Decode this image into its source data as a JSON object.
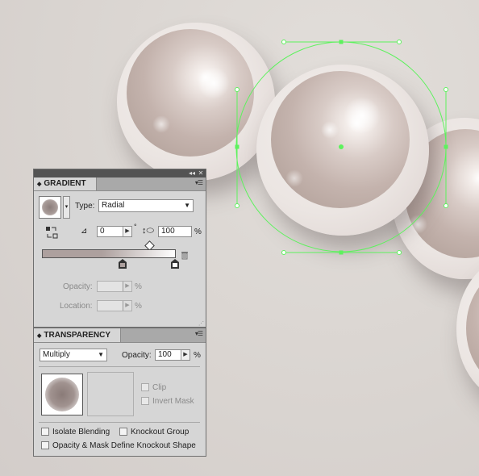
{
  "gradient_panel": {
    "tab_label": "GRADIENT",
    "type_label": "Type:",
    "type_value": "Radial",
    "angle_value": "0",
    "degree_symbol": "°",
    "aspect_value": "100",
    "aspect_unit": "%",
    "opacity_label": "Opacity:",
    "opacity_value": "",
    "opacity_unit": "%",
    "location_label": "Location:",
    "location_value": "",
    "location_unit": "%",
    "ramp_start_color": "#ada09e",
    "ramp_end_color": "#ffffff"
  },
  "transparency_panel": {
    "tab_label": "TRANSPARENCY",
    "blend_mode": "Multiply",
    "opacity_label": "Opacity:",
    "opacity_value": "100",
    "opacity_unit": "%",
    "clip_label": "Clip",
    "invert_mask_label": "Invert Mask",
    "isolate_blending_label": "Isolate Blending",
    "knockout_group_label": "Knockout Group",
    "opacity_mask_label": "Opacity & Mask Define Knockout Shape"
  },
  "colors": {
    "selection": "#5df25d",
    "panel_bg": "#d6d6d6",
    "panel_header": "#535353",
    "pearl_core": "#c4b3ad"
  }
}
